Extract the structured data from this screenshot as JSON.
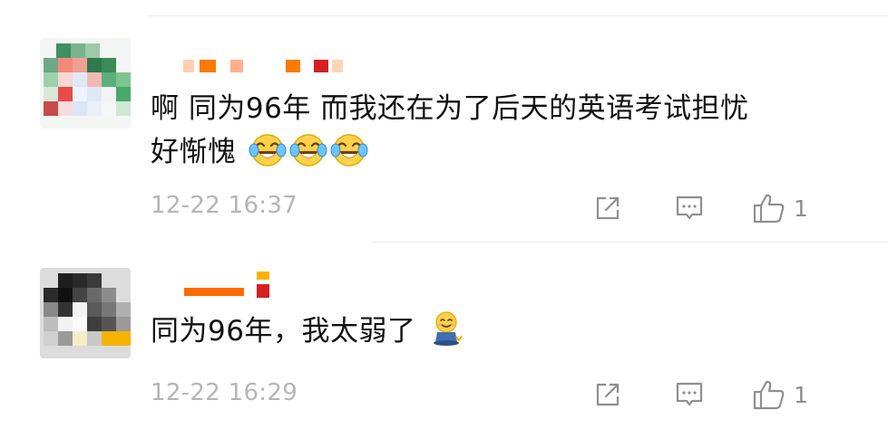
{
  "comments": [
    {
      "text_line1": "啊  同为96年  而我还在为了后天的英语考试担忧",
      "text_line2": "好惭愧",
      "emojis": [
        "laugh-cry-emoji",
        "laugh-cry-emoji",
        "laugh-cry-emoji"
      ],
      "time": "12-22 16:37",
      "likes": "1"
    },
    {
      "text_line1": "同为96年，我太弱了",
      "emojis": [
        "sitting-smile-emoji"
      ],
      "time": "12-22 16:29",
      "likes": "1"
    }
  ],
  "colors": {
    "accent_orange": "#ff7a00",
    "accent_red": "#e02020",
    "time_gray": "#b5b5b5",
    "icon_gray": "#8f8f8f"
  }
}
